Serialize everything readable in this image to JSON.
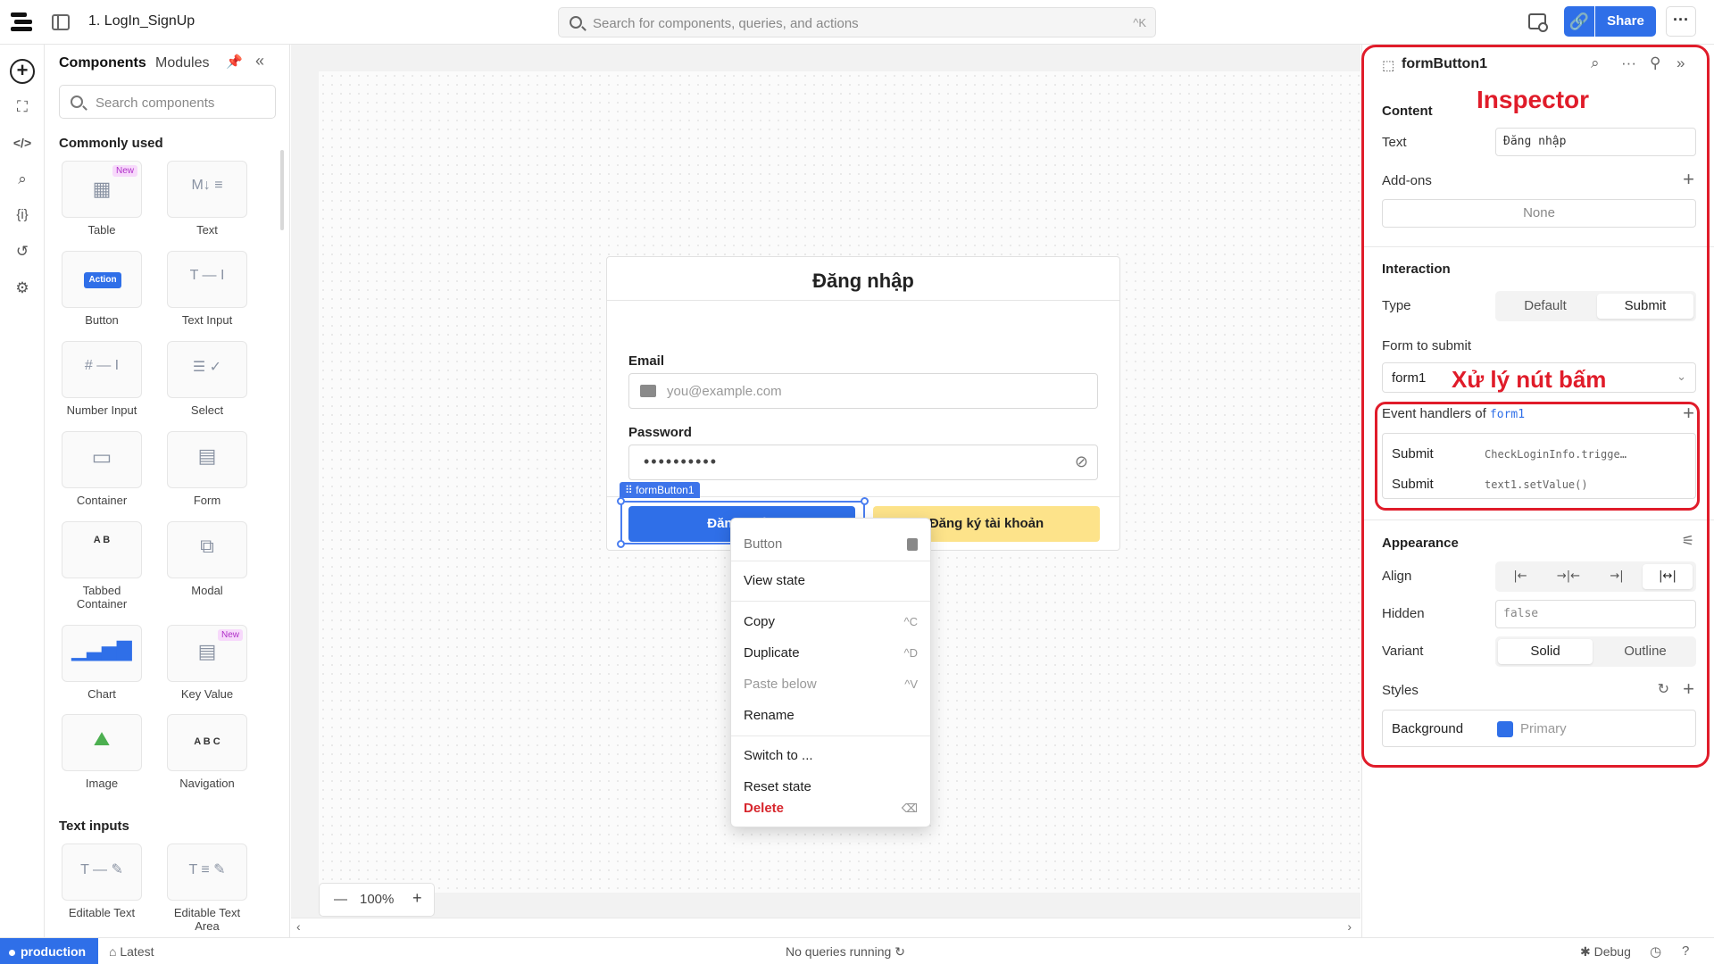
{
  "app": {
    "title": "1. LogIn_SignUp"
  },
  "topbar": {
    "search_placeholder": "Search for components, queries, and actions",
    "search_shortcut": "^K",
    "share_label": "Share",
    "link_icon": "link-icon",
    "more_label": "···"
  },
  "components_panel": {
    "tab_components": "Components",
    "tab_modules": "Modules",
    "search_placeholder": "Search components",
    "section_common": "Commonly used",
    "section_text_inputs": "Text inputs",
    "items": [
      {
        "label": "Table",
        "badge": "New",
        "icon": "table-icon"
      },
      {
        "label": "Text",
        "icon": "markdown-icon"
      },
      {
        "label": "Button",
        "button_text": "Action",
        "icon": "button-icon"
      },
      {
        "label": "Text Input",
        "icon": "text-input-icon"
      },
      {
        "label": "Number Input",
        "icon": "number-input-icon"
      },
      {
        "label": "Select",
        "icon": "select-icon"
      },
      {
        "label": "Container",
        "icon": "container-icon"
      },
      {
        "label": "Form",
        "icon": "form-icon"
      },
      {
        "label": "Tabbed Container",
        "tab_letters": "A B",
        "icon": "tabbed-container-icon"
      },
      {
        "label": "Modal",
        "icon": "modal-icon"
      },
      {
        "label": "Chart",
        "icon": "chart-icon"
      },
      {
        "label": "Key Value",
        "badge": "New",
        "icon": "key-value-icon"
      },
      {
        "label": "Image",
        "icon": "image-icon"
      },
      {
        "label": "Navigation",
        "nav_letters": "A B C",
        "icon": "navigation-icon"
      },
      {
        "label": "Editable Text",
        "icon": "editable-text-icon"
      },
      {
        "label": "Editable Text Area",
        "icon": "editable-text-area-icon"
      }
    ]
  },
  "canvas": {
    "form_title": "Đăng nhập",
    "email_label": "Email",
    "email_placeholder": "you@example.com",
    "password_label": "Password",
    "password_value": "••••••••••",
    "login_button": "Đăng nhập",
    "signup_button": "Đăng ký tài khoản",
    "selected_tag": "⠿ formButton1",
    "zoom": "100%"
  },
  "context_menu": {
    "header": "Button",
    "items": [
      {
        "label": "View state",
        "shortcut": ""
      },
      {
        "label": "Copy",
        "shortcut": "^C"
      },
      {
        "label": "Duplicate",
        "shortcut": "^D"
      },
      {
        "label": "Paste below",
        "shortcut": "^V"
      },
      {
        "label": "Rename",
        "shortcut": ""
      },
      {
        "label": "Switch to ...",
        "shortcut": ""
      },
      {
        "label": "Reset state",
        "shortcut": ""
      },
      {
        "label": "Delete",
        "shortcut": "⌫"
      }
    ]
  },
  "inspector": {
    "component_name": "formButton1",
    "annotation_inspector": "Inspector",
    "annotation_handlers": "Xử lý nút bấm",
    "content": {
      "section": "Content",
      "text_label": "Text",
      "text_value": "Đăng nhập",
      "addons_label": "Add-ons",
      "addons_value": "None"
    },
    "interaction": {
      "section": "Interaction",
      "type_label": "Type",
      "type_options": [
        "Default",
        "Submit"
      ],
      "type_selected": "Submit",
      "form_label": "Form to submit",
      "form_value": "form1",
      "handlers_label": "Event handlers of ",
      "handlers_target": "form1",
      "handlers": [
        {
          "event": "Submit",
          "action": "CheckLoginInfo.trigge…"
        },
        {
          "event": "Submit",
          "action": "text1.setValue()"
        }
      ]
    },
    "appearance": {
      "section": "Appearance",
      "align_label": "Align",
      "align_options": [
        "|←",
        "→|←",
        "→|",
        "|↔|"
      ],
      "hidden_label": "Hidden",
      "hidden_value": "false",
      "variant_label": "Variant",
      "variant_options": [
        "Solid",
        "Outline"
      ],
      "variant_selected": "Solid",
      "styles_label": "Styles",
      "background_label": "Background",
      "background_value": "Primary",
      "background_color": "#2f6fe8"
    }
  },
  "statusbar": {
    "environment": "production",
    "version": "Latest",
    "queries": "No queries running",
    "debug": "Debug"
  },
  "colors": {
    "accent": "#2f6fe8",
    "signup": "#fde38a",
    "annotation": "#e01c2a",
    "danger": "#d7262d"
  }
}
